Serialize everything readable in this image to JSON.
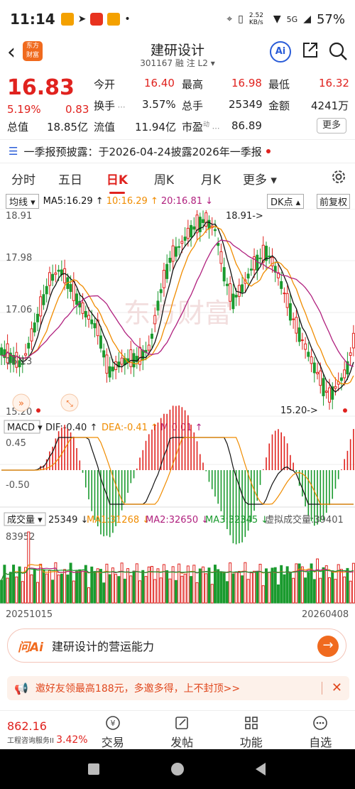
{
  "status_bar": {
    "time": "11:14",
    "net_speed": "2.52 KB/s",
    "network": "5G",
    "battery": "57%"
  },
  "header": {
    "stock_name": "建研设计",
    "stock_code": "301167",
    "tags": "融 注 L2",
    "logo_text_1": "东方",
    "logo_text_2": "财富",
    "ai_label": "Ai"
  },
  "quote": {
    "price": "16.83",
    "change_pct": "5.19%",
    "change": "0.83",
    "open_label": "今开",
    "open": "16.40",
    "high_label": "最高",
    "high": "16.98",
    "low_label": "最低",
    "low": "16.32",
    "turnover_label": "换手",
    "turnover": "3.57%",
    "volume_label": "总手",
    "volume": "25349",
    "amount_label": "金额",
    "amount": "4241万",
    "mktcap_label": "总值",
    "mktcap": "18.85亿",
    "float_label": "流值",
    "float_cap": "11.94亿",
    "pe_label": "市盈",
    "pe_sup": "动",
    "pe": "86.89",
    "more_label": "更多"
  },
  "notice": {
    "text": "一季报预披露：于2026-04-24披露2026年一季报"
  },
  "period_tabs": [
    {
      "label": "分时"
    },
    {
      "label": "五日"
    },
    {
      "label": "日K"
    },
    {
      "label": "周K"
    },
    {
      "label": "月K"
    },
    {
      "label": "更多 ▾"
    }
  ],
  "ma_legend": {
    "selector": "均线 ▾",
    "ma5": "MA5:16.29 ↑",
    "ma10": "10:16.29 ↑",
    "ma20": "20:16.81 ↓",
    "dk": "DK点 ▴",
    "fq": "前复权"
  },
  "colors": {
    "up": "#e0221e",
    "down": "#1a9a2e",
    "ma5": "#111111",
    "ma10": "#f08c00",
    "ma20": "#b0207e",
    "accent": "#f06a1e"
  },
  "chart_data": {
    "type": "candlestick",
    "price_axis_labels": [
      "18.91",
      "17.98",
      "17.06",
      "16.13",
      "15.20"
    ],
    "high_marker": "18.91->",
    "low_marker": "15.20->",
    "macd_legend": {
      "selector": "MACD ▾",
      "dif": "DIF:-0.40 ↑",
      "dea": "DEA:-0.41 ↑",
      "m": "M:0.01 ↑"
    },
    "macd_axis_labels": [
      "0.45",
      "-0.50"
    ],
    "volume_legend": {
      "selector": "成交量 ▾",
      "vol": "25349 ↓",
      "ma1": "MA1:31268 ↓",
      "ma2": "MA2:32650 ↓",
      "ma3": "MA3:32345 ↓",
      "virtual": "虚拟成交量:39401"
    },
    "volume_axis_label": "83952",
    "x_start": "20251015",
    "x_end": "20260408",
    "watermark": "东方财富"
  },
  "ai_bar": {
    "logo": "问Ai",
    "text": "建研设计的营运能力",
    "go": "→"
  },
  "promo": {
    "text": "邀好友领最高188元，多邀多得，上不封顶>>",
    "close": "✕"
  },
  "bottom_bar": {
    "index_value": "862.16",
    "index_name": "工程咨询服务II",
    "index_pct": "3.42%",
    "items": [
      {
        "label": "交易"
      },
      {
        "label": "发帖"
      },
      {
        "label": "功能"
      },
      {
        "label": "自选"
      }
    ]
  }
}
